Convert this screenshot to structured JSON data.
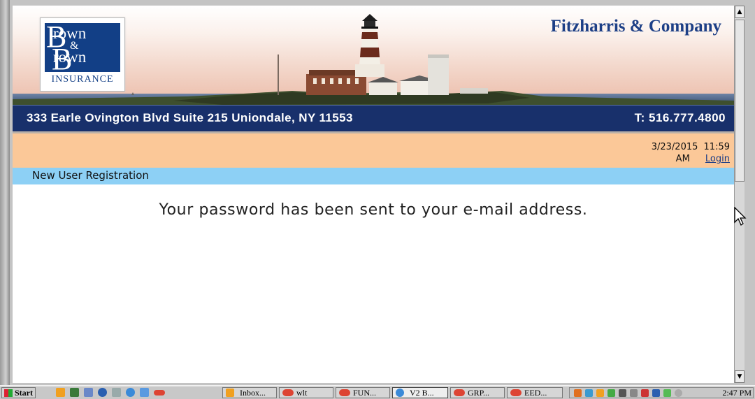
{
  "header": {
    "company": "Fitzharris & Company",
    "address": "333 Earle Ovington Blvd Suite 215 Uniondale, NY 11553",
    "phone": "T: 516.777.4800",
    "logo": {
      "line1": "rown",
      "amp": "&",
      "line2": "rown",
      "insurance": "INSURANCE"
    }
  },
  "datebar": {
    "date": "3/23/2015",
    "time": "11:59",
    "ampm": "AM",
    "login_label": "Login"
  },
  "section": {
    "title": "New User Registration"
  },
  "main": {
    "message": "Your password has been sent to your e-mail address."
  },
  "taskbar": {
    "start_label": "Start",
    "tasks": [
      {
        "label": "Inbox..."
      },
      {
        "label": "wlt"
      },
      {
        "label": "FUN..."
      },
      {
        "label": "V2 B..."
      },
      {
        "label": "GRP..."
      },
      {
        "label": "EED..."
      }
    ],
    "clock": "2:47 PM"
  },
  "colors": {
    "navy": "#18306b",
    "peach": "#fbc898",
    "sky": "#8dd0f5",
    "company_blue": "#1d3f86"
  }
}
